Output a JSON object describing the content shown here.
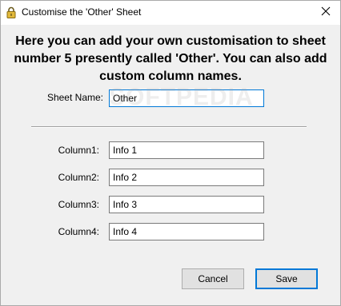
{
  "window": {
    "title": "Customise the 'Other' Sheet",
    "icon": "lock-icon",
    "close_icon": "close-icon"
  },
  "heading": "Here you can add your own customisation to sheet number 5 presently called 'Other'. You can also add custom column names.",
  "sheet_name": {
    "label": "Sheet Name:",
    "value": "Other"
  },
  "columns": [
    {
      "label": "Column1:",
      "value": "Info 1"
    },
    {
      "label": "Column2:",
      "value": "Info 2"
    },
    {
      "label": "Column3:",
      "value": "Info 3"
    },
    {
      "label": "Column4:",
      "value": "Info 4"
    }
  ],
  "buttons": {
    "cancel": "Cancel",
    "save": "Save"
  },
  "watermark": "SOFTPEDIA",
  "colors": {
    "focus_border": "#0078d7",
    "background": "#f0f0f0"
  }
}
